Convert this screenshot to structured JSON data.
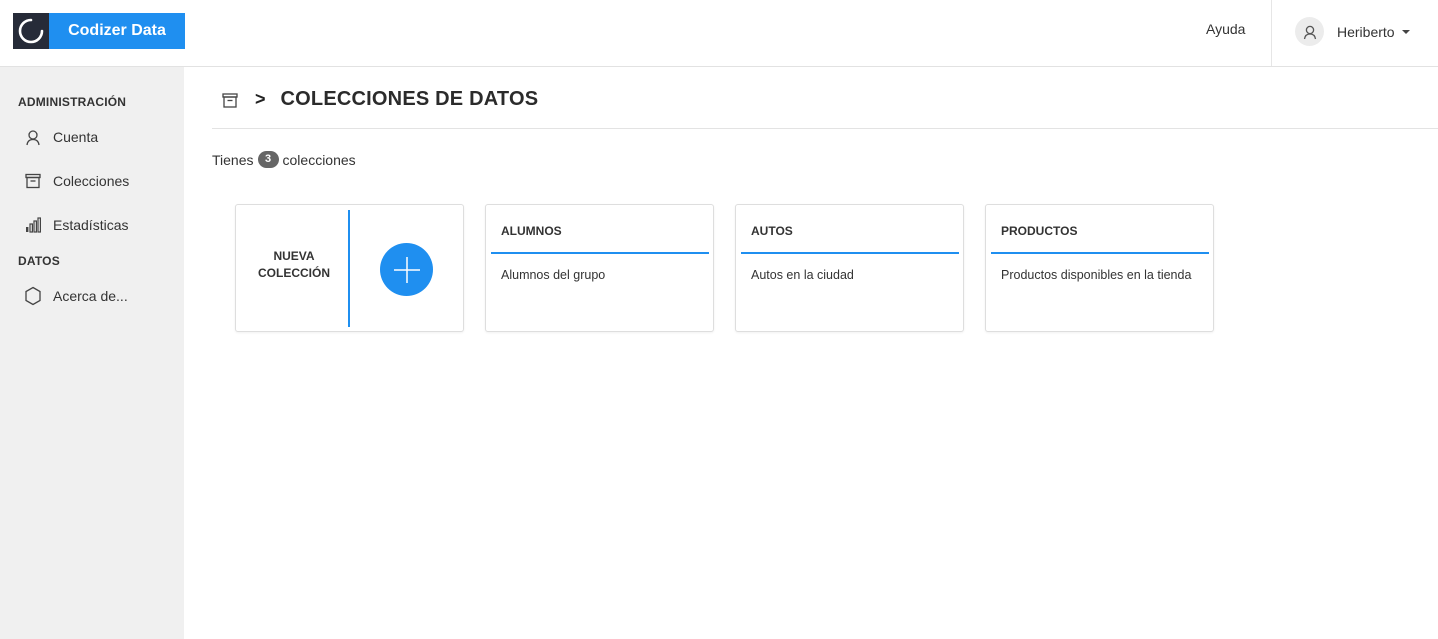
{
  "brand": {
    "name": "Codizer Data",
    "accent": "#1f8ff0",
    "dark": "#262b38"
  },
  "header": {
    "help_label": "Ayuda",
    "user_name": "Heriberto",
    "user_icon": "user-icon"
  },
  "sidebar": {
    "sections": [
      {
        "title": "ADMINISTRACIÓN"
      },
      {
        "title": "DATOS"
      }
    ],
    "items": [
      {
        "label": "Cuenta",
        "icon": "user-icon"
      },
      {
        "label": "Colecciones",
        "icon": "archive-box-icon"
      },
      {
        "label": "Estadísticas",
        "icon": "bar-chart-icon"
      },
      {
        "label": "Acerca de...",
        "icon": "hexagon-icon"
      }
    ]
  },
  "main": {
    "breadcrumb_icon": "archive-box-icon",
    "breadcrumb_separator": ">",
    "title": "COLECCIONES DE DATOS",
    "count_prefix": "Tienes",
    "count": "3",
    "count_suffix": "colecciones",
    "new_card": {
      "label_line1": "NUEVA",
      "label_line2": "COLECCIÓN",
      "icon": "plus-icon"
    },
    "collections": [
      {
        "title": "ALUMNOS",
        "description": "Alumnos del grupo"
      },
      {
        "title": "AUTOS",
        "description": "Autos en la ciudad"
      },
      {
        "title": "PRODUCTOS",
        "description": "Productos disponibles en la tienda"
      }
    ]
  }
}
